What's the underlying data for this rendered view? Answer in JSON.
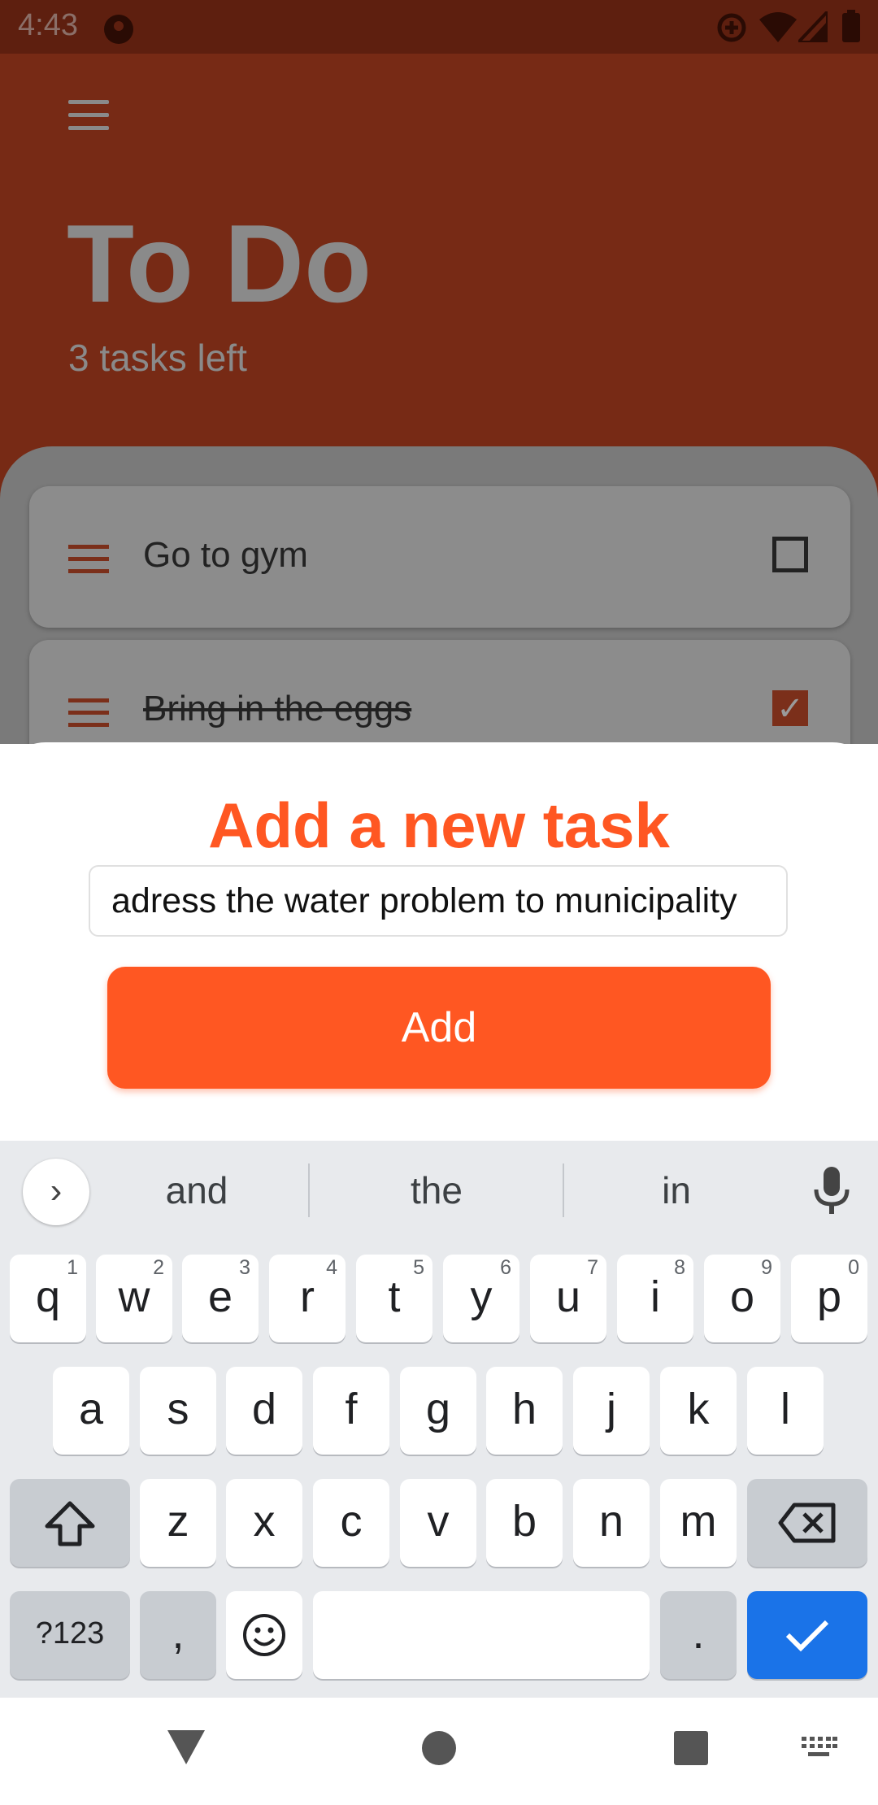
{
  "status_bar": {
    "time": "4:43"
  },
  "header": {
    "title": "To Do",
    "subtitle": "3 tasks left"
  },
  "tasks": [
    {
      "label": "Go to gym",
      "done": false
    },
    {
      "label": "Bring in the eggs",
      "done": true
    }
  ],
  "sheet": {
    "title": "Add a new task",
    "input_value": "adress the water problem to municipality",
    "add_label": "Add"
  },
  "keyboard": {
    "suggestions": [
      "and",
      "the",
      "in"
    ],
    "row1": [
      [
        "q",
        "1"
      ],
      [
        "w",
        "2"
      ],
      [
        "e",
        "3"
      ],
      [
        "r",
        "4"
      ],
      [
        "t",
        "5"
      ],
      [
        "y",
        "6"
      ],
      [
        "u",
        "7"
      ],
      [
        "i",
        "8"
      ],
      [
        "o",
        "9"
      ],
      [
        "p",
        "0"
      ]
    ],
    "row2": [
      "a",
      "s",
      "d",
      "f",
      "g",
      "h",
      "j",
      "k",
      "l"
    ],
    "row3": [
      "z",
      "x",
      "c",
      "v",
      "b",
      "n",
      "m"
    ],
    "symbols_label": "?123",
    "comma": ",",
    "period": "."
  },
  "colors": {
    "accent": "#ff5722",
    "keyboard_action": "#1a73e8",
    "scrim_app": "#772a15"
  },
  "icons": [
    "menu-icon",
    "checkbox-icon",
    "check-icon",
    "chevron-right-icon",
    "mic-icon",
    "shift-icon",
    "backspace-icon",
    "emoji-icon",
    "back-icon",
    "home-icon",
    "recents-icon",
    "keyboard-icon"
  ]
}
